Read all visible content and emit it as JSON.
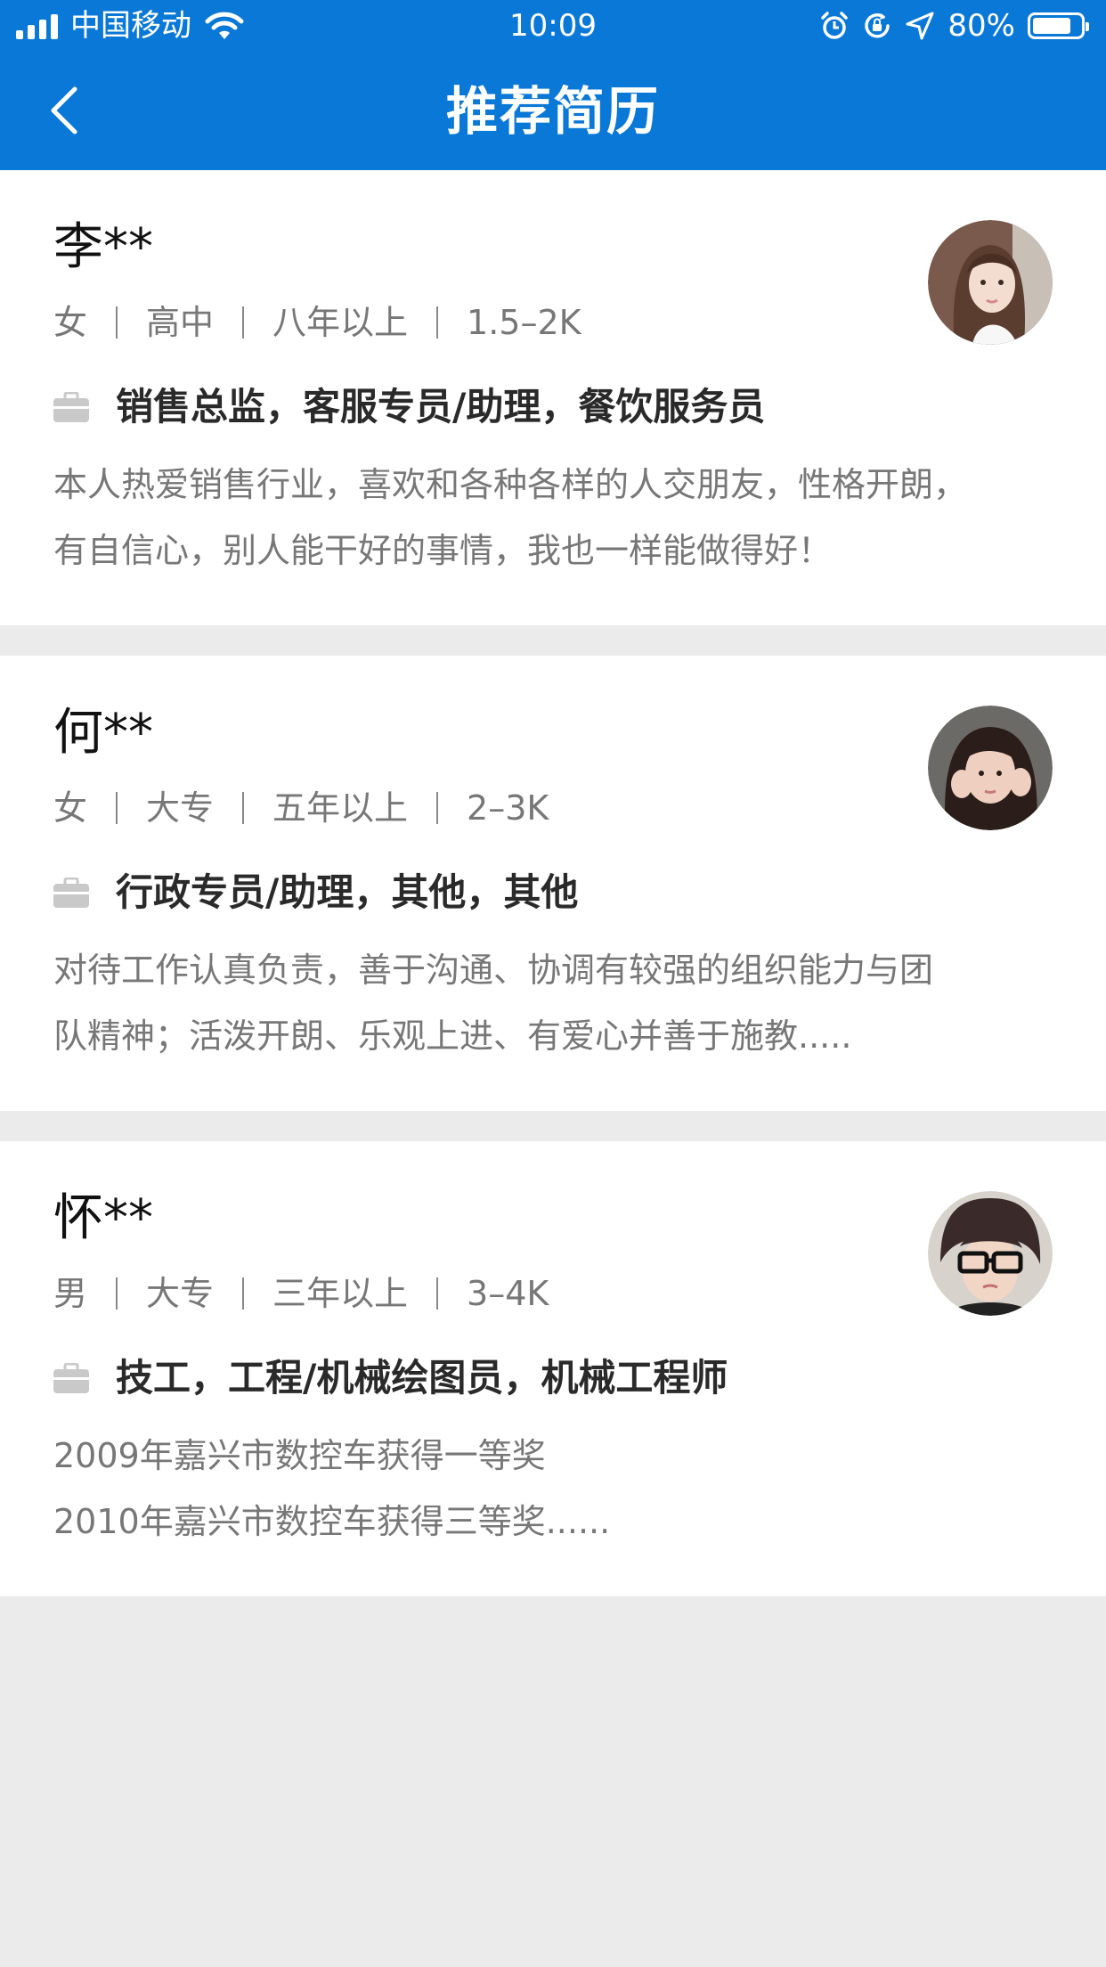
{
  "status_bar": {
    "carrier": "中国移动",
    "time": "10:09",
    "battery": "80%",
    "battery_level": 0.8
  },
  "nav": {
    "title": "推荐简历",
    "back_icon": "chevron-left-icon"
  },
  "colors": {
    "primary": "#0a78d6",
    "background": "#ebebeb",
    "card": "#ffffff",
    "muted_text": "#777777"
  },
  "resumes": [
    {
      "name": "李**",
      "gender": "女",
      "education": "高中",
      "experience": "八年以上",
      "salary": "1.5–2K",
      "positions": "销售总监，客服专员/助理，餐饮服务员",
      "description_lines": [
        "本人热爱销售行业，喜欢和各种各样的人交朋友，性格开朗，",
        "有自信心，别人能干好的事情，我也一样能做得好！"
      ],
      "avatar_icon": "avatar-photo"
    },
    {
      "name": "何**",
      "gender": "女",
      "education": "大专",
      "experience": "五年以上",
      "salary": "2–3K",
      "positions": "行政专员/助理，其他，其他",
      "description_lines": [
        "对待工作认真负责，善于沟通、协调有较强的组织能力与团",
        "队精神；活泼开朗、乐观上进、有爱心并善于施教....."
      ],
      "avatar_icon": "avatar-photo"
    },
    {
      "name": "怀**",
      "gender": "男",
      "education": "大专",
      "experience": "三年以上",
      "salary": "3–4K",
      "positions": "技工，工程/机械绘图员，机械工程师",
      "description_lines": [
        "2009年嘉兴市数控车获得一等奖",
        "2010年嘉兴市数控车获得三等奖......"
      ],
      "avatar_icon": "avatar-photo"
    }
  ]
}
